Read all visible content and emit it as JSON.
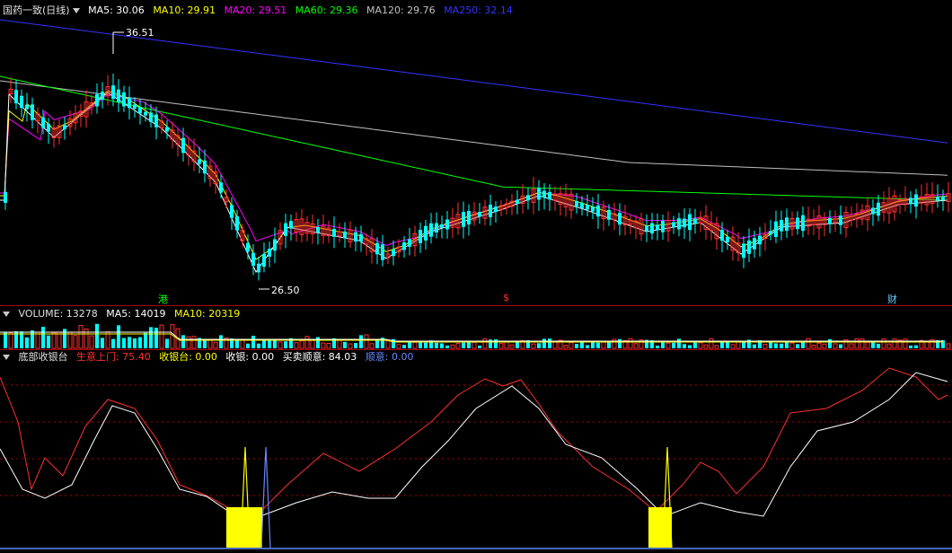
{
  "price_panel": {
    "title": "国药一致(日线)",
    "ma": [
      {
        "label": "MA5: 30.06",
        "color": "#ffffff"
      },
      {
        "label": "MA10: 29.91",
        "color": "#ffff00"
      },
      {
        "label": "MA20: 29.51",
        "color": "#ff00ff"
      },
      {
        "label": "MA60: 29.36",
        "color": "#00ff00"
      },
      {
        "label": "MA120: 29.76",
        "color": "#c0c0c0"
      },
      {
        "label": "MA250: 32.14",
        "color": "#3333ff"
      }
    ],
    "high_label": "36.51",
    "low_label": "26.50",
    "events": [
      {
        "text": "港",
        "color": "#00ff00"
      },
      {
        "text": "$",
        "color": "#ff3030"
      },
      {
        "text": "财",
        "color": "#66ccff"
      }
    ]
  },
  "volume_panel": {
    "title": "VOLUME: 13278",
    "ma5": "MA5: 14019",
    "ma10": "MA10: 20319"
  },
  "indicator_panel": {
    "title": "底部收银台",
    "items": [
      {
        "label": "生意上门: 75.40",
        "color": "#ff3030"
      },
      {
        "label": "收银台: 0.00",
        "color": "#ffff00"
      },
      {
        "label": "收银: 0.00",
        "color": "#ffffff"
      },
      {
        "label": "买卖顺意: 84.03",
        "color": "#ffffff"
      },
      {
        "label": "顺意: 0.00",
        "color": "#6688ff"
      }
    ]
  },
  "colors": {
    "up": "#ff3030",
    "down": "#00ffff",
    "grid": "#b00000"
  }
}
